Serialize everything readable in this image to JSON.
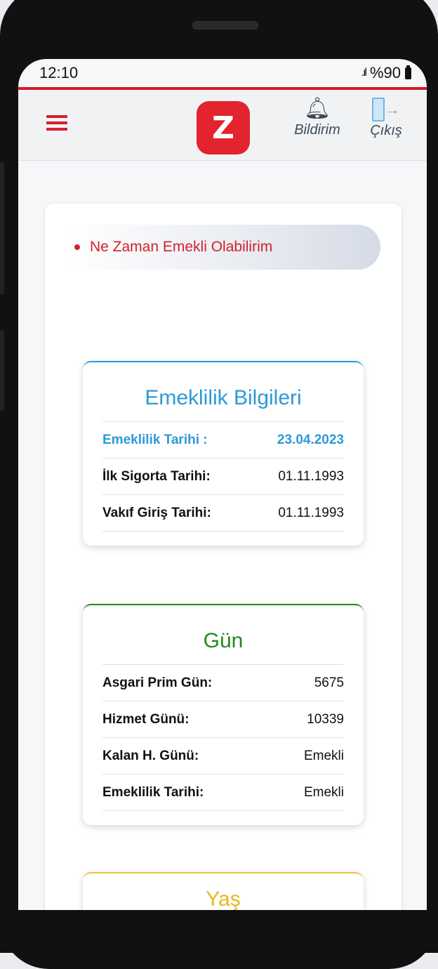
{
  "status_bar": {
    "time": "12:10",
    "signal": ".ıl",
    "battery": "%90"
  },
  "app_bar": {
    "logo_text": "Z",
    "bildirim_label": "Bildirim",
    "cikis_label": "Çıkış"
  },
  "tab": {
    "label": "Ne Zaman Emekli Olabilirim"
  },
  "emeklilik_card": {
    "title": "Emeklilik Bilgileri",
    "rows": [
      {
        "label": "Emeklilik Tarihi :",
        "value": "23.04.2023"
      },
      {
        "label": "İlk Sigorta Tarihi:",
        "value": "01.11.1993"
      },
      {
        "label": "Vakıf Giriş Tarihi:",
        "value": "01.11.1993"
      }
    ]
  },
  "gun_card": {
    "title": "Gün",
    "rows": [
      {
        "label": "Asgari Prim Gün:",
        "value": "5675"
      },
      {
        "label": "Hizmet Günü:",
        "value": "10339"
      },
      {
        "label": "Kalan H. Günü:",
        "value": "Emekli"
      },
      {
        "label": "Emeklilik Tarihi:",
        "value": "Emekli"
      }
    ]
  },
  "yas_card": {
    "title": "Yaş"
  },
  "colors": {
    "brand_red": "#d3202c",
    "blue": "#2b9ad8",
    "green": "#1e8b1e",
    "yellow": "#e9b91c"
  }
}
